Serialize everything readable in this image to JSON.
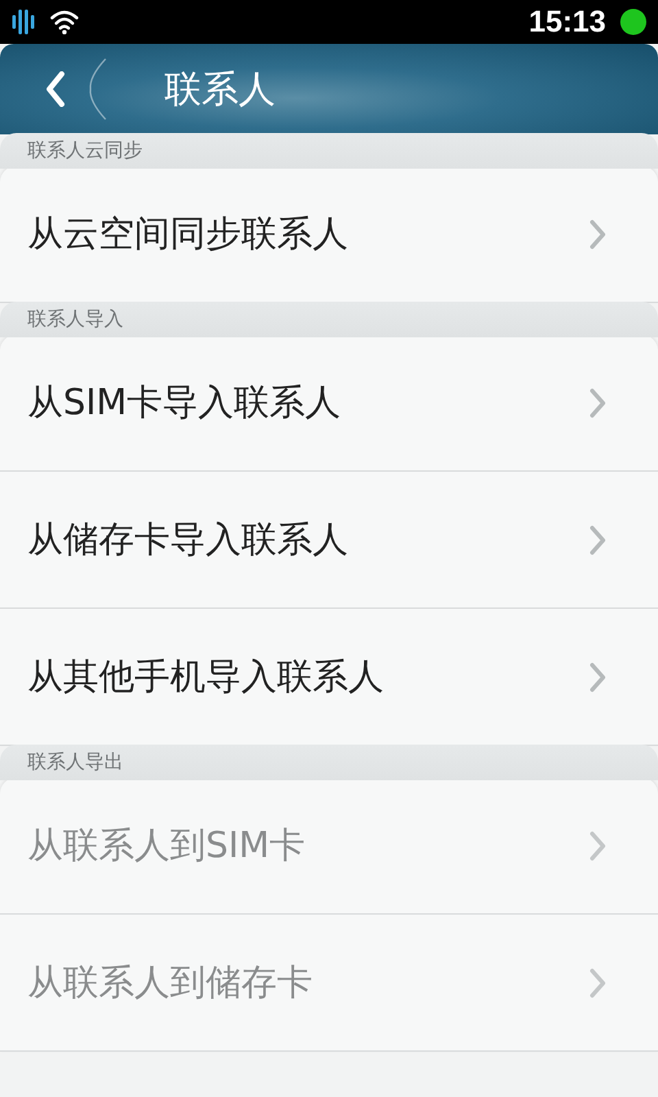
{
  "status_bar": {
    "time": "15:13"
  },
  "header": {
    "title": "联系人"
  },
  "sections": [
    {
      "label": "联系人云同步",
      "items": [
        {
          "label": "从云空间同步联系人",
          "disabled": false
        }
      ]
    },
    {
      "label": "联系人导入",
      "items": [
        {
          "label": "从SIM卡导入联系人",
          "disabled": false
        },
        {
          "label": "从储存卡导入联系人",
          "disabled": false
        },
        {
          "label": "从其他手机导入联系人",
          "disabled": false
        }
      ]
    },
    {
      "label": "联系人导出",
      "items": [
        {
          "label": "从联系人到SIM卡",
          "disabled": true
        },
        {
          "label": "从联系人到储存卡",
          "disabled": true
        }
      ]
    }
  ]
}
